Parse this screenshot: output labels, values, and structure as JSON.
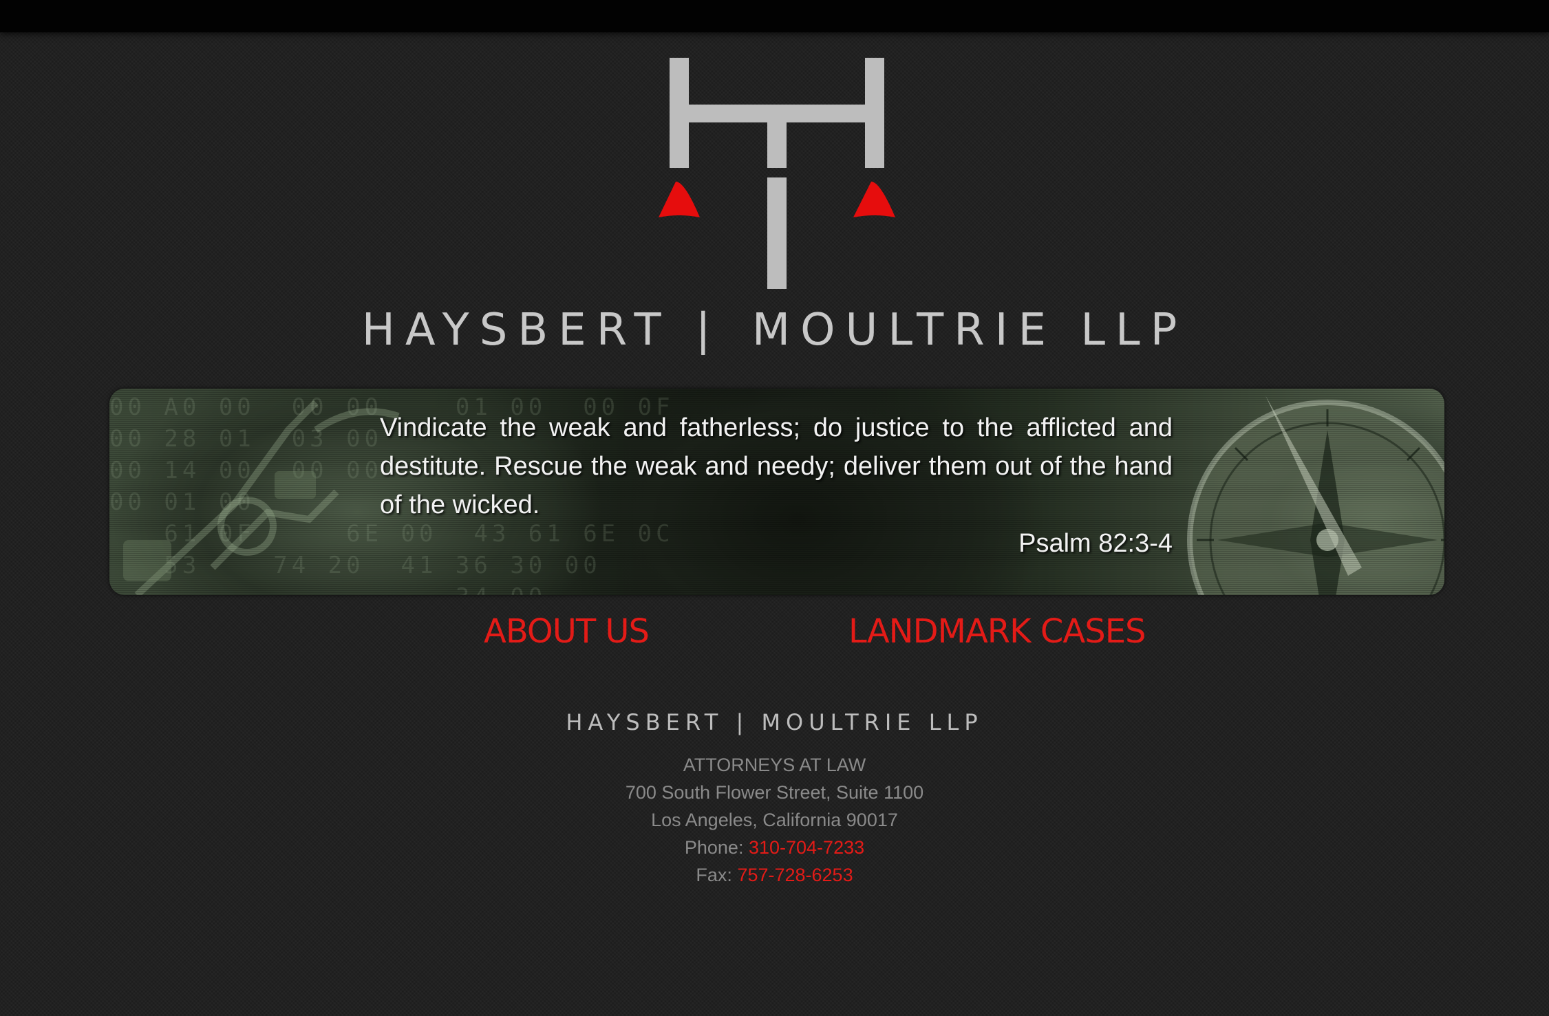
{
  "header": {
    "firm_name_left": "HAYSBERT",
    "separator": "|",
    "firm_name_right": "MOULTRIE LLP"
  },
  "banner": {
    "quote": "Vindicate the weak and fatherless; do justice to the afflicted and destitute. Rescue the weak and needy; deliver them out of the hand of the wicked.",
    "citation": "Psalm 82:3-4"
  },
  "nav": {
    "about_label": "ABOUT US",
    "cases_label": "LANDMARK CASES"
  },
  "footer": {
    "firm_name_left": "HAYSBERT",
    "separator": "|",
    "firm_name_right": "MOULTRIE LLP",
    "tagline": "ATTORNEYS AT LAW",
    "address_line1": "700 South Flower Street, Suite 1100",
    "address_line2": "Los Angeles, California 90017",
    "phone_label": "Phone:",
    "phone_number": "310-704-7233",
    "fax_label": "Fax:",
    "fax_number": "757-728-6253"
  },
  "colors": {
    "accent_red": "#e41b17",
    "logo_gray": "#bdbdbd",
    "background": "#1e1e1e"
  },
  "icons": {
    "logo": "scales-of-justice-monogram-icon",
    "banner_left": "instrument-icon",
    "banner_right": "compass-icon"
  }
}
